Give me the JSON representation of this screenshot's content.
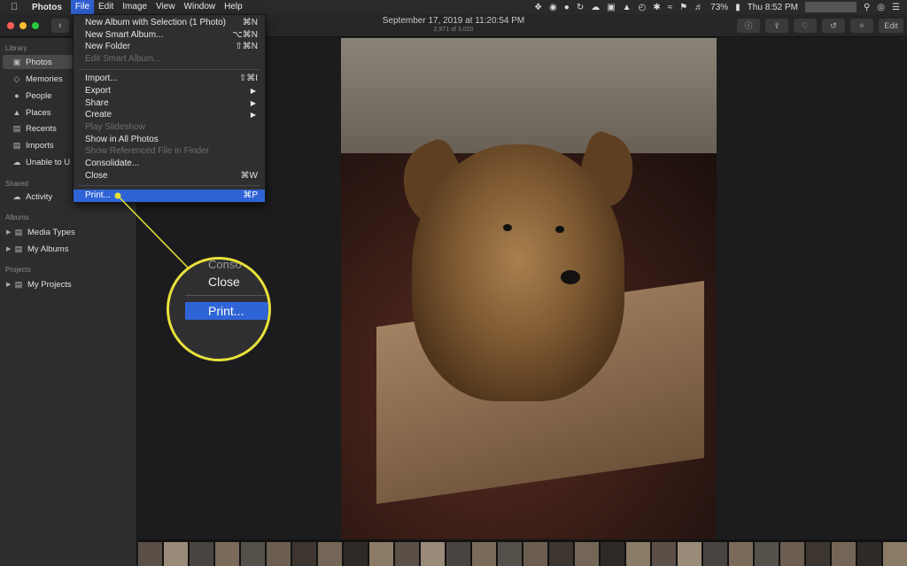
{
  "menubar": {
    "app": "Photos",
    "menus": [
      "File",
      "Edit",
      "Image",
      "View",
      "Window",
      "Help"
    ],
    "active_menu": "File",
    "battery": "73%",
    "clock": "Thu 8:52 PM"
  },
  "toolbar": {
    "title": "September 17, 2019 at 11:20:54 PM",
    "subtitle": "2,971 of 3,020",
    "edit_label": "Edit"
  },
  "sidebar": {
    "library_header": "Library",
    "library_items": [
      {
        "label": "Photos",
        "icon": "photos-icon"
      },
      {
        "label": "Memories",
        "icon": "memories-icon"
      },
      {
        "label": "People",
        "icon": "people-icon"
      },
      {
        "label": "Places",
        "icon": "places-icon"
      },
      {
        "label": "Recents",
        "icon": "recents-icon"
      },
      {
        "label": "Imports",
        "icon": "imports-icon"
      },
      {
        "label": "Unable to U",
        "icon": "cloud-icon"
      }
    ],
    "shared_header": "Shared",
    "shared_items": [
      {
        "label": "Activity",
        "icon": "cloud-icon"
      }
    ],
    "albums_header": "Albums",
    "album_items": [
      {
        "label": "Media Types",
        "icon": "folder-icon"
      },
      {
        "label": "My Albums",
        "icon": "folder-icon"
      }
    ],
    "projects_header": "Projects",
    "project_items": [
      {
        "label": "My Projects",
        "icon": "folder-icon"
      }
    ]
  },
  "file_menu": {
    "items": [
      {
        "label": "New Album with Selection (1 Photo)",
        "shortcut": "⌘N"
      },
      {
        "label": "New Smart Album...",
        "shortcut": "⌥⌘N"
      },
      {
        "label": "New Folder",
        "shortcut": "⇧⌘N"
      },
      {
        "label": "Edit Smart Album...",
        "shortcut": ""
      },
      {
        "label": "Import...",
        "shortcut": "⇧⌘I"
      },
      {
        "label": "Export",
        "shortcut": ""
      },
      {
        "label": "Share",
        "shortcut": ""
      },
      {
        "label": "Create",
        "shortcut": ""
      },
      {
        "label": "Play Slideshow",
        "shortcut": ""
      },
      {
        "label": "Show in All Photos",
        "shortcut": ""
      },
      {
        "label": "Show Referenced File in Finder",
        "shortcut": ""
      },
      {
        "label": "Consolidate...",
        "shortcut": ""
      },
      {
        "label": "Close",
        "shortcut": "⌘W"
      },
      {
        "label": "Print...",
        "shortcut": "⌘P"
      }
    ]
  },
  "callout": {
    "partial": "Conso",
    "close": "Close",
    "print": "Print..."
  },
  "colors": {
    "highlight": "#2f64d6",
    "callout": "#e8e23a"
  }
}
